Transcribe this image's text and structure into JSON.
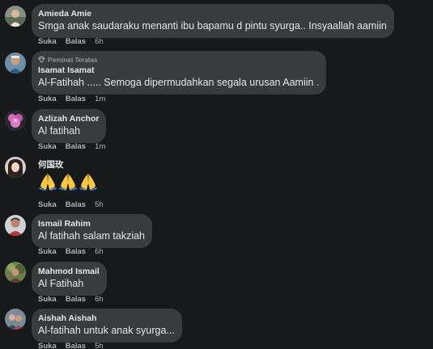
{
  "comments": [
    {
      "author": "Amieda Amie",
      "text": "Smga anak saudaraku menanti ibu bapamu d pintu syurga.. Insyaallah aamiin",
      "like": "Suka",
      "reply": "Balas",
      "time": "6h"
    },
    {
      "badge": "Peminat Teratas",
      "author": "Isamat Isamat",
      "text": "Al-Fatihah ..... Semoga dipermudahkan segala urusan Aamiin .",
      "like": "Suka",
      "reply": "Balas",
      "time": "1m"
    },
    {
      "author": "Azlizah Anchor",
      "text": "Al fatihah",
      "like": "Suka",
      "reply": "Balas",
      "time": "1m"
    },
    {
      "author": "何国玫",
      "emoji": [
        "folded-hands",
        "folded-hands",
        "folded-hands"
      ],
      "like": "Suka",
      "reply": "Balas",
      "time": "5h"
    },
    {
      "author": "Ismail Rahim",
      "text": "Al fatihah salam takziah",
      "like": "Suka",
      "reply": "Balas",
      "time": "6h"
    },
    {
      "author": "Mahmod Ismail",
      "text": "Al Fatihah",
      "like": "Suka",
      "reply": "Balas",
      "time": "6h"
    },
    {
      "author": "Aishah Aishah",
      "text": "Al-fatihah untuk anak syurga...",
      "like": "Suka",
      "reply": "Balas",
      "time": "5h"
    }
  ],
  "colors": {
    "background": "#18191a",
    "bubble": "#3a3b3c",
    "text_primary": "#e4e6eb",
    "text_secondary": "#b0b3b8"
  }
}
